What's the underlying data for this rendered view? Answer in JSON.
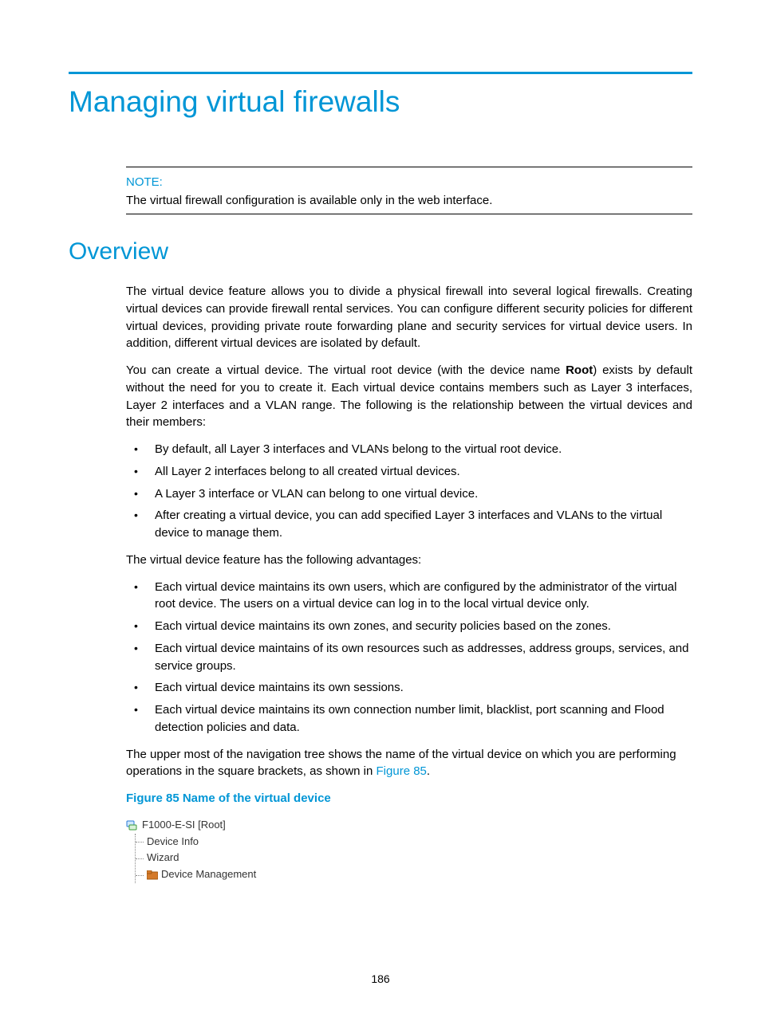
{
  "title": "Managing virtual firewalls",
  "note": {
    "label": "NOTE:",
    "text": "The virtual firewall configuration is available only in the web interface."
  },
  "section_heading": "Overview",
  "para1": "The virtual device feature allows you to divide a physical firewall into several logical firewalls. Creating virtual devices can provide firewall rental services. You can configure different security policies for different virtual devices, providing private route forwarding plane and security services for virtual device users. In addition, different virtual devices are isolated by default.",
  "para2_pre": "You can create a virtual device. The virtual root device (with the device name ",
  "para2_bold": "Root",
  "para2_post": ") exists by default without the need for you to create it. Each virtual device contains members such as Layer 3 interfaces, Layer 2 interfaces and a VLAN range. The following is the relationship between the virtual devices and their members:",
  "list1": [
    "By default, all Layer 3 interfaces and VLANs belong to the virtual root device.",
    "All Layer 2 interfaces belong to all created virtual devices.",
    "A Layer 3 interface or VLAN can belong to one virtual device.",
    "After creating a virtual device, you can add specified Layer 3 interfaces and VLANs to the virtual device to manage them."
  ],
  "para3": "The virtual device feature has the following advantages:",
  "list2": [
    "Each virtual device maintains its own users, which are configured by the administrator of the virtual root device. The users on a virtual device can log in to the local virtual device only.",
    "Each virtual device maintains its own zones, and security policies based on the zones.",
    "Each virtual device maintains of its own resources such as addresses, address groups, services, and service groups.",
    "Each virtual device maintains its own sessions.",
    "Each virtual device maintains its own connection number limit, blacklist, port scanning and Flood detection policies and data."
  ],
  "para4_pre": "The upper most of the navigation tree shows the name of the virtual device on which you are performing operations in the square brackets, as shown in ",
  "para4_link": "Figure 85",
  "para4_post": ".",
  "figure_caption": "Figure 85 Name of the virtual device",
  "tree": {
    "root": "F1000-E-SI [Root]",
    "children": [
      "Device Info",
      "Wizard",
      "Device Management"
    ]
  },
  "page_number": "186"
}
